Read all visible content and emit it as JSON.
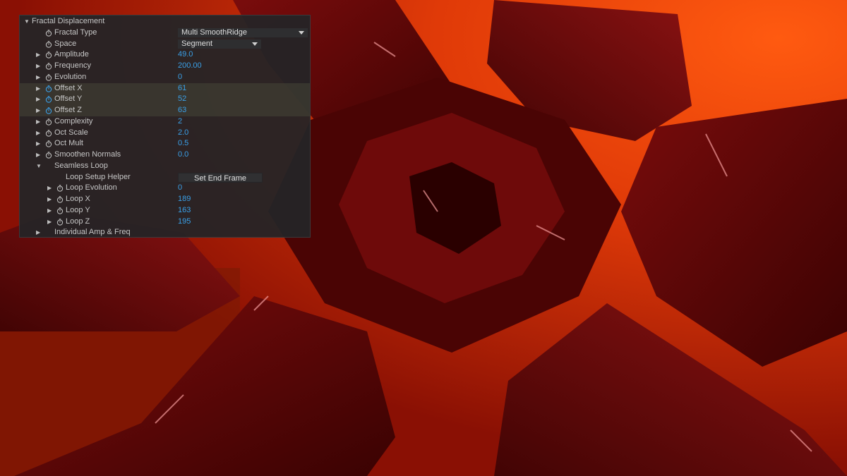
{
  "colors": {
    "panel_bg": "#242426",
    "label_text": "#c6c6c6",
    "value_blue": "#3aa0e8",
    "stopwatch_active": "#3aa0e8",
    "background_orange": "#e4420c",
    "background_red": "#5a0606"
  },
  "panel": {
    "rows": [
      {
        "label": "Fractal Displacement",
        "depth": 0,
        "twirl": "open",
        "stopwatch": false,
        "value": ""
      },
      {
        "label": "Fractal Type",
        "depth": 1,
        "twirl": "none",
        "stopwatch": true,
        "value": ""
      },
      {
        "label": "Space",
        "depth": 1,
        "twirl": "none",
        "stopwatch": true,
        "value": ""
      },
      {
        "label": "Amplitude",
        "depth": 1,
        "twirl": "closed",
        "stopwatch": true,
        "value": "49.0"
      },
      {
        "label": "Frequency",
        "depth": 1,
        "twirl": "closed",
        "stopwatch": true,
        "value": "200.00"
      },
      {
        "label": "Evolution",
        "depth": 1,
        "twirl": "closed",
        "stopwatch": true,
        "value": "0"
      },
      {
        "label": "Offset X",
        "depth": 1,
        "twirl": "closed",
        "stopwatch": true,
        "stopwatch_active": true,
        "highlight": true,
        "value": "61"
      },
      {
        "label": "Offset Y",
        "depth": 1,
        "twirl": "closed",
        "stopwatch": true,
        "stopwatch_active": true,
        "highlight": true,
        "value": "52"
      },
      {
        "label": "Offset Z",
        "depth": 1,
        "twirl": "closed",
        "stopwatch": true,
        "stopwatch_active": true,
        "highlight": true,
        "value": "63"
      },
      {
        "label": "Complexity",
        "depth": 1,
        "twirl": "closed",
        "stopwatch": true,
        "value": "2"
      },
      {
        "label": "Oct Scale",
        "depth": 1,
        "twirl": "closed",
        "stopwatch": true,
        "value": "2.0"
      },
      {
        "label": "Oct Mult",
        "depth": 1,
        "twirl": "closed",
        "stopwatch": true,
        "value": "0.5"
      },
      {
        "label": "Smoothen Normals",
        "depth": 1,
        "twirl": "closed",
        "stopwatch": true,
        "value": "0.0"
      },
      {
        "label": "Seamless Loop",
        "depth": 1,
        "twirl": "open",
        "stopwatch": false,
        "value": ""
      },
      {
        "label": "Loop Setup Helper",
        "depth": 2,
        "twirl": "none",
        "stopwatch": false,
        "value": ""
      },
      {
        "label": "Loop Evolution",
        "depth": 2,
        "twirl": "closed",
        "stopwatch": true,
        "value": "0"
      },
      {
        "label": "Loop X",
        "depth": 2,
        "twirl": "closed",
        "stopwatch": true,
        "value": "189"
      },
      {
        "label": "Loop Y",
        "depth": 2,
        "twirl": "closed",
        "stopwatch": true,
        "value": "163"
      },
      {
        "label": "Loop Z",
        "depth": 2,
        "twirl": "closed",
        "stopwatch": true,
        "value": "195"
      },
      {
        "label": "Individual Amp & Freq",
        "depth": 1,
        "twirl": "closed",
        "stopwatch": false,
        "value": ""
      }
    ],
    "fractal_type_value": "Multi SmoothRidge",
    "space_value": "Segment",
    "set_end_frame_label": "Set End Frame",
    "icons": {
      "twirl_open": "▼",
      "twirl_closed": "▶",
      "stopwatch": "stopwatch-icon",
      "dropdown": "chevron-down-icon"
    }
  }
}
